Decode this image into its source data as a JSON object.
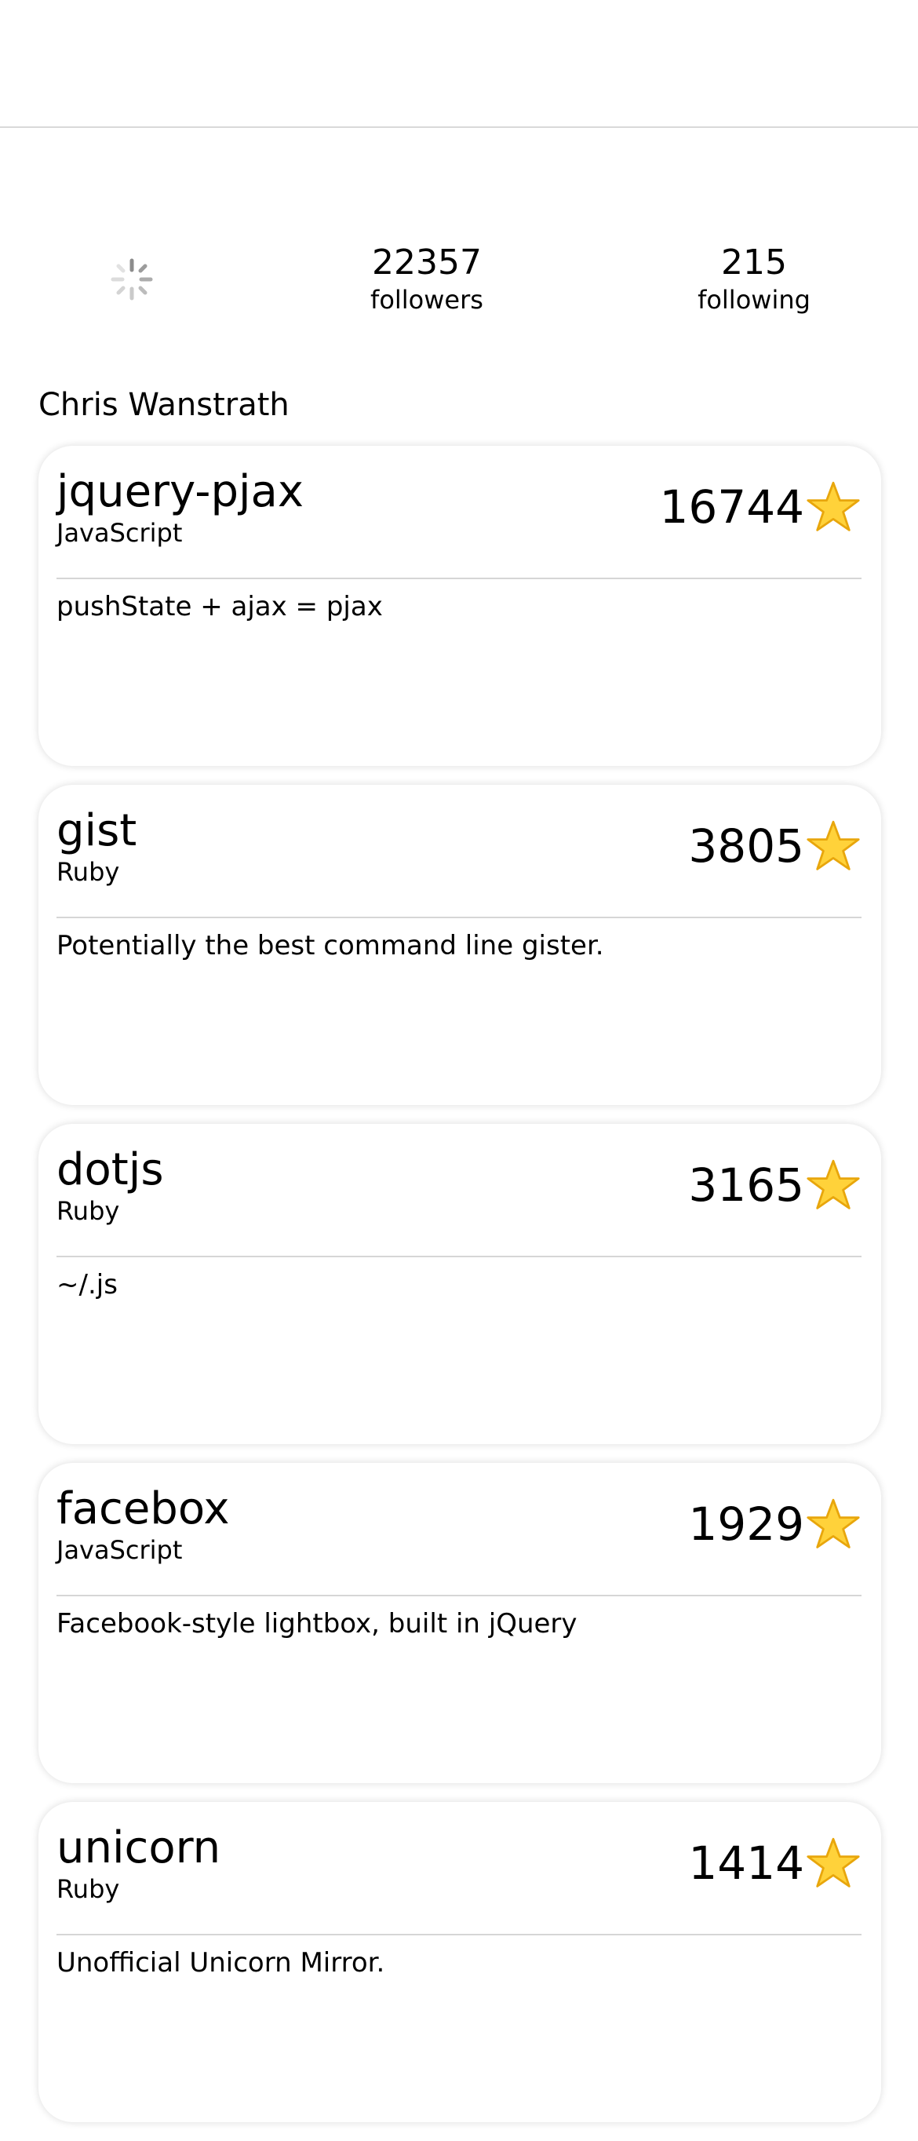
{
  "profile": {
    "name": "Chris Wanstrath",
    "followers_count": "22357",
    "followers_label": "followers",
    "following_count": "215",
    "following_label": "following"
  },
  "repos": [
    {
      "name": "jquery-pjax",
      "language": "JavaScript",
      "stars": "16744",
      "description": "pushState + ajax = pjax"
    },
    {
      "name": "gist",
      "language": "Ruby",
      "stars": "3805",
      "description": "Potentially the best command line gister."
    },
    {
      "name": "dotjs",
      "language": "Ruby",
      "stars": "3165",
      "description": "~/.js"
    },
    {
      "name": "facebox",
      "language": "JavaScript",
      "stars": "1929",
      "description": "Facebook-style lightbox, built in jQuery"
    },
    {
      "name": "unicorn",
      "language": "Ruby",
      "stars": "1414",
      "description": "Unofficial Unicorn Mirror."
    }
  ],
  "icons": {
    "star": "star-icon",
    "spinner": "loading-spinner-icon"
  },
  "colors": {
    "star_fill": "#FFD23A",
    "star_stroke": "#E8A60C",
    "divider": "#D6D6D6",
    "spinner": "#9A9A9A"
  }
}
